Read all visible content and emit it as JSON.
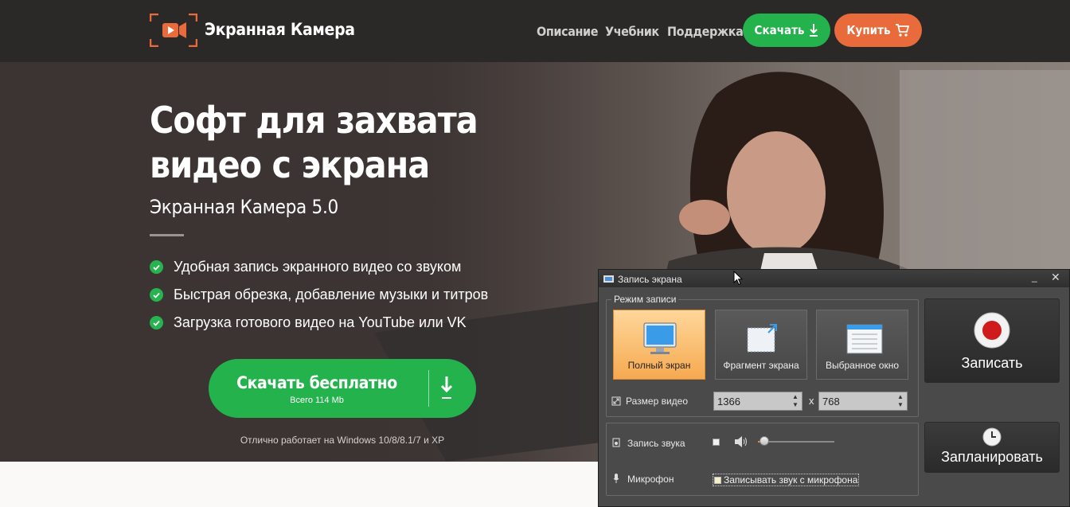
{
  "header": {
    "brand": "Экранная Камера",
    "nav": [
      "Описание",
      "Учебник",
      "Поддержка"
    ],
    "download_label": "Скачать",
    "buy_label": "Купить"
  },
  "hero": {
    "title_line1": "Софт для захвата",
    "title_line2": "видео с экрана",
    "subtitle": "Экранная Камера 5.0",
    "features": [
      "Удобная запись экранного видео со звуком",
      "Быстрая обрезка, добавление музыки и титров",
      "Загрузка готового видео на YouTube или VK"
    ],
    "cta_label": "Скачать бесплатно",
    "cta_size": "Всего 114 Mb",
    "compat": "Отлично работает на Windows 10/8/8.1/7 и XP"
  },
  "app": {
    "window_title": "Запись экрана",
    "mode_group_label": "Режим записи",
    "modes": [
      "Полный экран",
      "Фрагмент экрана",
      "Выбранное окно"
    ],
    "active_mode": "Полный экран",
    "size_label": "Размер видео",
    "width": "1366",
    "height": "768",
    "times": "x",
    "record_label": "Записать",
    "schedule_label": "Запланировать",
    "sound_label": "Запись звука",
    "mic_label": "Микрофон",
    "mic_checkbox_label": "Записывать звук с микрофона",
    "volume_level": 0.08
  },
  "colors": {
    "header_bg": "#2b2828",
    "green": "#24b24d",
    "orange": "#e96b3b"
  }
}
